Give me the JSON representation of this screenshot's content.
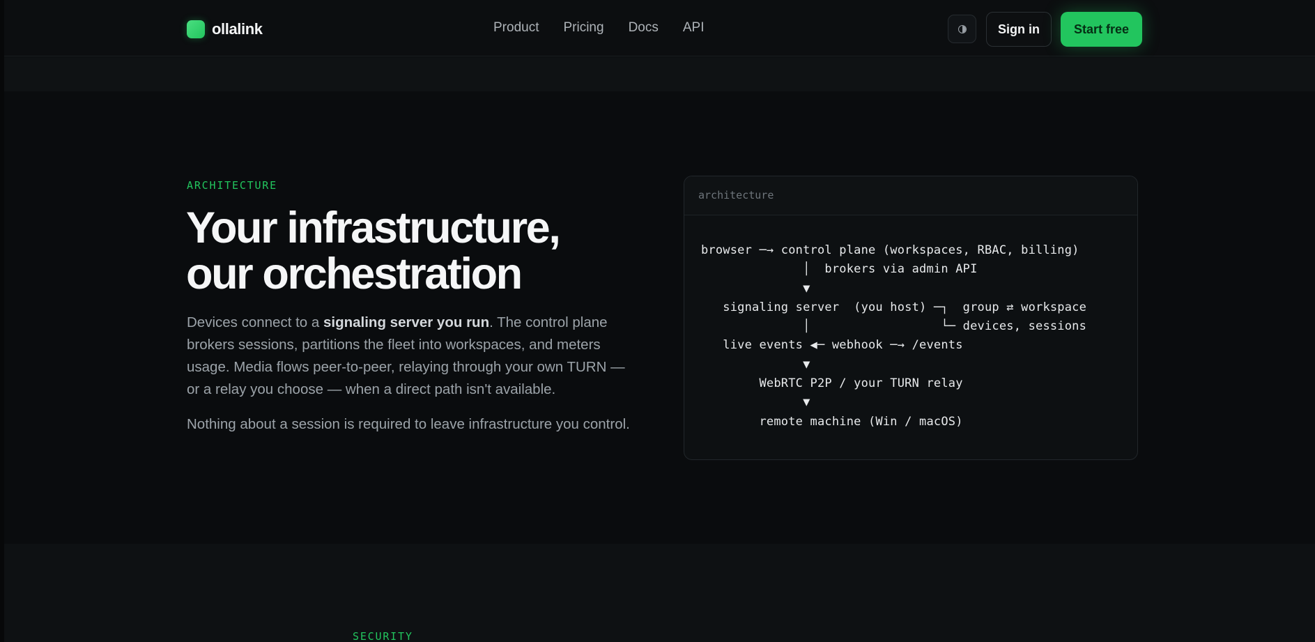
{
  "brand": {
    "name": "ollalink",
    "accent": "#22c55e"
  },
  "nav": {
    "items": [
      "Product",
      "Pricing",
      "Docs",
      "API"
    ]
  },
  "header": {
    "theme_toggle_icon": "half-circle-icon",
    "signin_label": "Sign in",
    "cta_label": "Start free"
  },
  "architecture": {
    "eyebrow": "ARCHITECTURE",
    "headline_line1": "Your infrastructure,",
    "headline_line2": "our orchestration",
    "p1_before": "Devices connect to a ",
    "p1_bold": "signaling server you run",
    "p1_after": ". The control plane brokers sessions, partitions the fleet into workspaces, and meters usage. Media flows peer-to-peer, relaying through your own TURN — or a relay you choose — when a direct path isn't available.",
    "p2": "Nothing about a session is required to leave infrastructure you control.",
    "card_title": "architecture",
    "diagram": "browser ─→ control plane (workspaces, RBAC, billing)\n              │  brokers via admin API\n              ▼\n   signaling server  (you host) ─┐  group ⇄ workspace\n              │                  └─ devices, sessions\n   live events ◀─ webhook ─→ /events\n              ▼\n        WebRTC P2P / your TURN relay\n              ▼\n        remote machine (Win / macOS)"
  },
  "security": {
    "eyebrow": "SECURITY"
  }
}
